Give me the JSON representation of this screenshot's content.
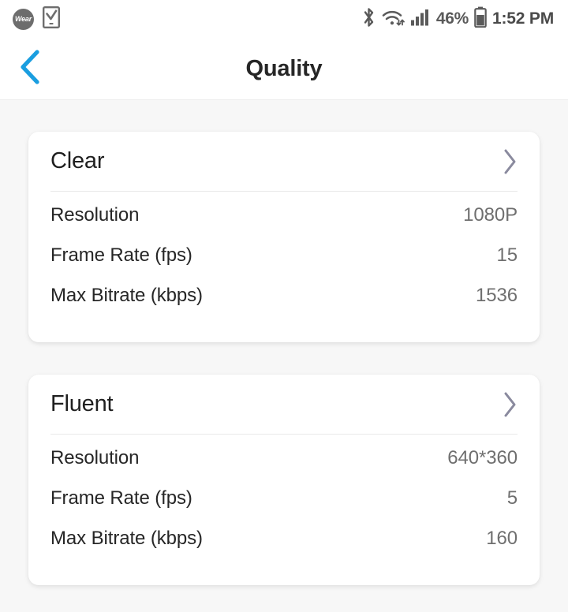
{
  "statusbar": {
    "left_icons": [
      {
        "name": "wear-badge-icon",
        "label": "Wear"
      },
      {
        "name": "phone-checkbox-icon",
        "label": ""
      }
    ],
    "bluetooth_icon": "bluetooth-icon",
    "wifi_icon": "wifi-icon",
    "signal_icon": "cellular-signal-icon",
    "battery_percent": "46%",
    "battery_icon": "battery-icon",
    "clock": "1:52 PM"
  },
  "header": {
    "back_icon": "back-chevron-icon",
    "back_color": "#1a9ee0",
    "title": "Quality"
  },
  "colors": {
    "page_background": "#f7f7f7",
    "card_background": "#ffffff",
    "accent": "#1a9ee0",
    "chevron": "#8a8a9e",
    "label_text": "#262626",
    "value_text": "#6f6f6f"
  },
  "cards": [
    {
      "title": "Clear",
      "chevron_icon": "chevron-right-icon",
      "rows": [
        {
          "label": "Resolution",
          "value": "1080P"
        },
        {
          "label": "Frame Rate (fps)",
          "value": "15"
        },
        {
          "label": "Max Bitrate (kbps)",
          "value": "1536"
        }
      ]
    },
    {
      "title": "Fluent",
      "chevron_icon": "chevron-right-icon",
      "rows": [
        {
          "label": "Resolution",
          "value": "640*360"
        },
        {
          "label": "Frame Rate (fps)",
          "value": "5"
        },
        {
          "label": "Max Bitrate (kbps)",
          "value": "160"
        }
      ]
    }
  ]
}
